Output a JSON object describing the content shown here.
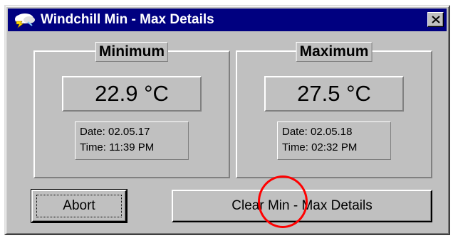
{
  "window": {
    "title": "Windchill Min - Max Details",
    "close_symbol": "✕",
    "icon": "windchill-app-icon"
  },
  "minimum": {
    "label": "Minimum",
    "value": "22.9 °C",
    "date": "Date: 02.05.17",
    "time": "Time: 11:39 PM"
  },
  "maximum": {
    "label": "Maximum",
    "value": "27.5 °C",
    "date": "Date: 02.05.18",
    "time": "Time: 02:32 PM"
  },
  "buttons": {
    "abort": "Abort",
    "clear": "Clear Min - Max Details"
  },
  "colors": {
    "titlebar": "#000080",
    "face": "#c0c0c0",
    "highlight": "#ff0000"
  }
}
